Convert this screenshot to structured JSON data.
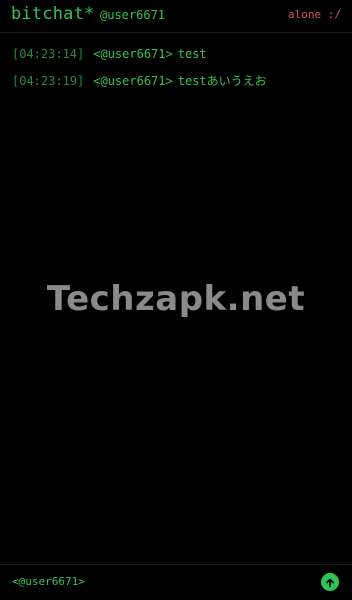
{
  "header": {
    "app_title": "bitchat*",
    "nickname": "@user6671",
    "status": "alone :/"
  },
  "messages": [
    {
      "timestamp": "[04:23:14]",
      "sender": "<@user6671>",
      "text": "test"
    },
    {
      "timestamp": "[04:23:19]",
      "sender": "<@user6671>",
      "text": "testあいうえお"
    }
  ],
  "watermark": "Techzapk.net",
  "composer": {
    "prompt": "<@user6671>",
    "input_value": "",
    "send_icon": "arrow-up-icon"
  },
  "colors": {
    "background": "#000000",
    "accent_green": "#33c24f",
    "timestamp_green": "#2a8a3e",
    "status_red": "#d9534f",
    "send_button": "#30c452"
  }
}
